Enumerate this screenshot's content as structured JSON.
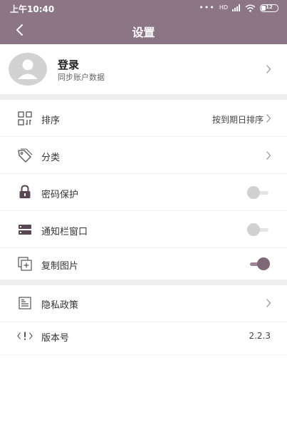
{
  "status_bar": {
    "time": "上午10:40",
    "signal_label": "HD",
    "battery_level": "12"
  },
  "header": {
    "title": "设置"
  },
  "account": {
    "title": "登录",
    "subtitle": "同步账户数据"
  },
  "settings": {
    "sort": {
      "label": "排序",
      "value": "按到期日排序"
    },
    "category": {
      "label": "分类"
    },
    "password": {
      "label": "密码保护",
      "enabled": false
    },
    "notification": {
      "label": "通知栏窗口",
      "enabled": false
    },
    "copy_image": {
      "label": "复制图片",
      "enabled": true
    },
    "privacy": {
      "label": "隐私政策"
    },
    "version": {
      "label": "版本号",
      "value": "2.2.3"
    }
  },
  "colors": {
    "accent": "#8c7584",
    "toggle_on": "#7f6878",
    "divider": "#eeeeee"
  },
  "icons": {
    "back": "chevron-left-icon",
    "sort": "grid-sort-icon",
    "category": "tag-icon",
    "password": "lock-icon",
    "notification": "notification-bar-icon",
    "copy_image": "copy-image-icon",
    "privacy": "document-icon",
    "version": "code-icon"
  }
}
